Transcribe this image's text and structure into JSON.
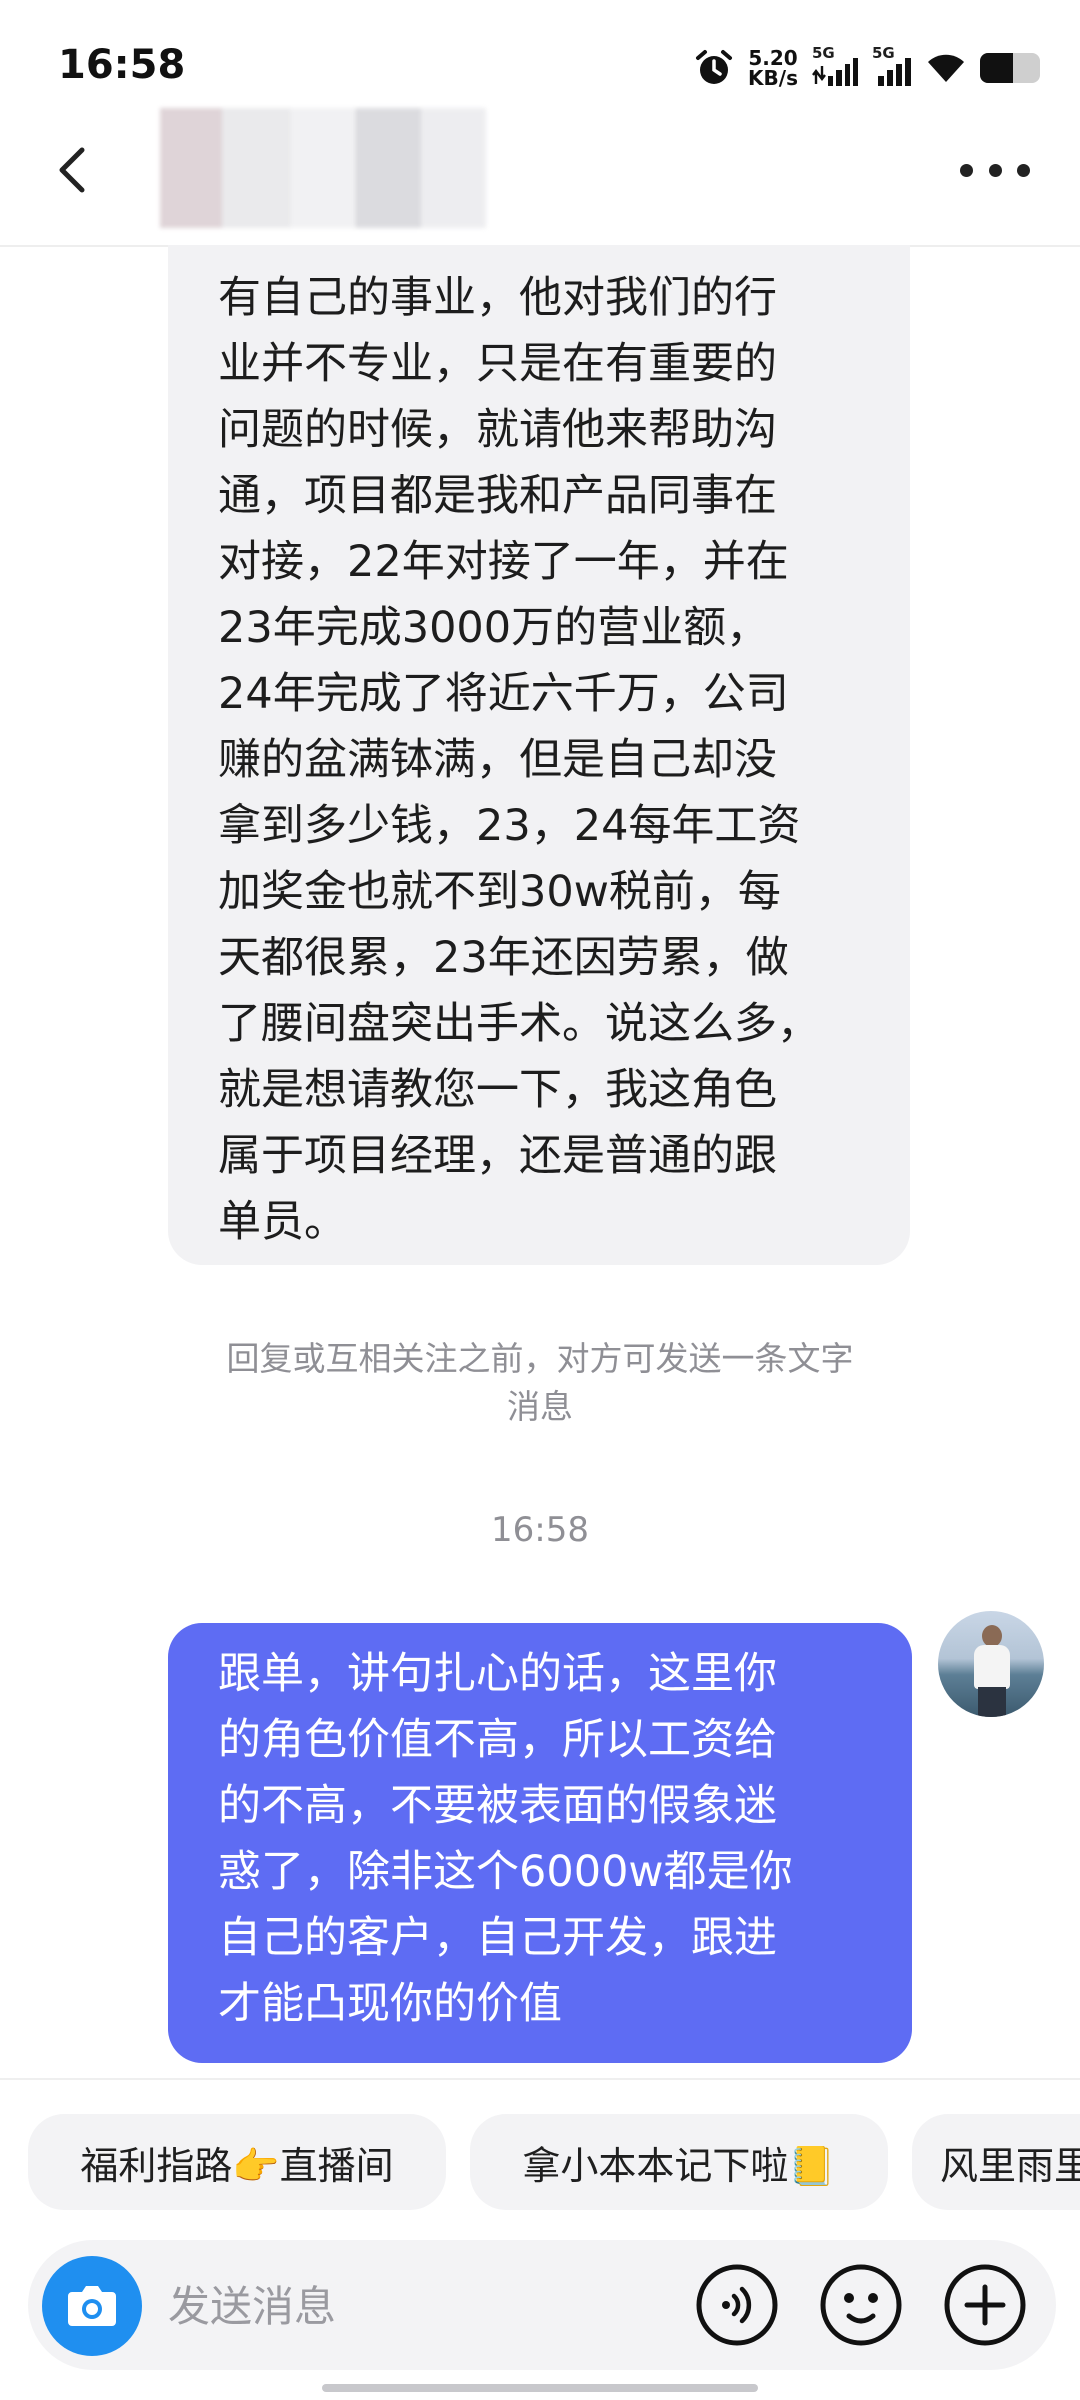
{
  "status_bar": {
    "time": "16:58",
    "net_speed_value": "5.20",
    "net_speed_unit": "KB/s",
    "sim1_label": "5G",
    "sim2_label": "5G",
    "battery_level": 0.55,
    "icons": [
      "alarm-icon",
      "signal-icon",
      "signal-icon",
      "wifi-icon",
      "battery-icon"
    ]
  },
  "header": {
    "back_icon": "chevron-left-icon",
    "contact_name": "",
    "more_icon": "more-horizontal-icon"
  },
  "messages": {
    "incoming": {
      "text": "有自己的事业，他对我们的行\n业并不专业，只是在有重要的\n问题的时候，就请他来帮助沟\n通，项目都是我和产品同事在\n对接，22年对接了一年，并在\n23年完成3000万的营业额，\n24年完成了将近六千万，公司\n赚的盆满钵满，但是自己却没\n拿到多少钱，23，24每年工资\n加奖金也就不到30w税前，每\n天都很累，23年还因劳累，做\n了腰间盘突出手术。说这么多，\n就是想请教您一下，我这角色\n属于项目经理，还是普通的跟\n单员。"
    },
    "system_note": "回复或互相关注之前，对方可发送一条文字\n消息",
    "timestamp": "16:58",
    "outgoing": {
      "text": "跟单，讲句扎心的话，这里你\n的角色价值不高，所以工资给\n的不高，不要被表面的假象迷\n惑了，除非这个6000w都是你\n自己的客户，自己开发，跟进\n才能凸现你的价值"
    }
  },
  "quick_replies": [
    {
      "label": "福利指路👉直播间"
    },
    {
      "label": "拿小本本记下啦📒"
    },
    {
      "label": "风里雨里"
    }
  ],
  "input_bar": {
    "placeholder": "发送消息",
    "camera_icon": "camera-icon",
    "voice_icon": "voice-icon",
    "emoji_icon": "emoji-icon",
    "add_icon": "plus-icon"
  },
  "colors": {
    "outgoing_bubble": "#5e6cf3",
    "incoming_bubble": "#f2f2f4",
    "camera_button": "#1f8ff0"
  }
}
